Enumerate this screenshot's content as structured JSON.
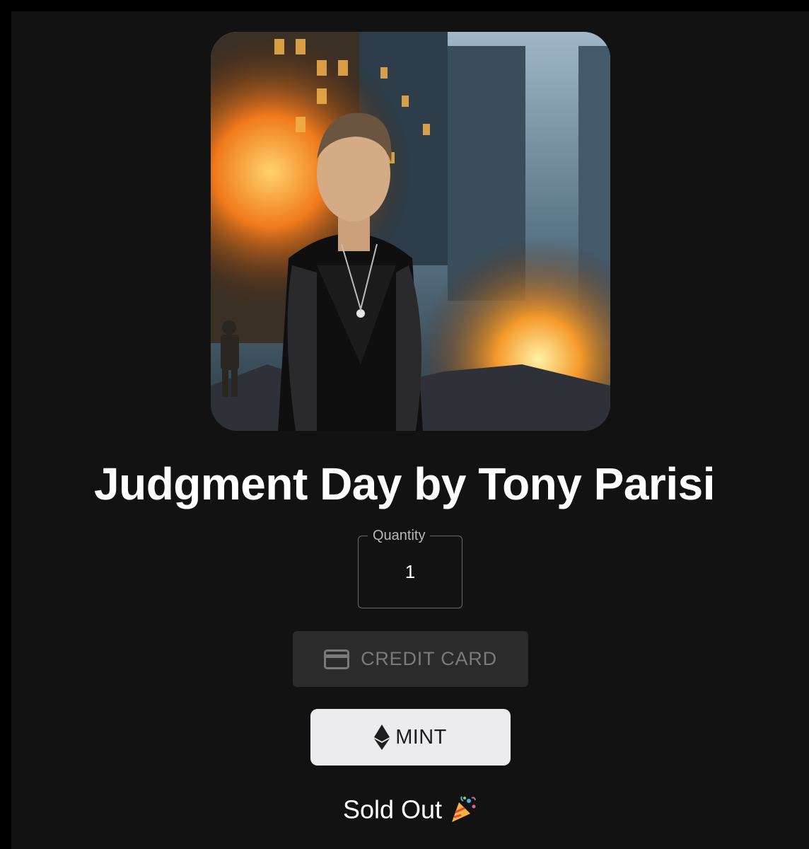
{
  "nft": {
    "title": "Judgment Day by Tony Parisi",
    "artwork_icon": "artwork-image"
  },
  "quantity": {
    "label": "Quantity",
    "value": "1"
  },
  "payment": {
    "credit_card_label": "CREDIT CARD",
    "credit_card_icon": "credit-card-icon",
    "mint_label": "MINT",
    "mint_icon": "ethereum-icon"
  },
  "status": {
    "text": "Sold Out",
    "emoji_icon": "party-popper-icon"
  },
  "colors": {
    "background": "#121212",
    "outer": "#000000",
    "mint_button": "#ececef",
    "credit_card_button": "#2b2b2b"
  }
}
